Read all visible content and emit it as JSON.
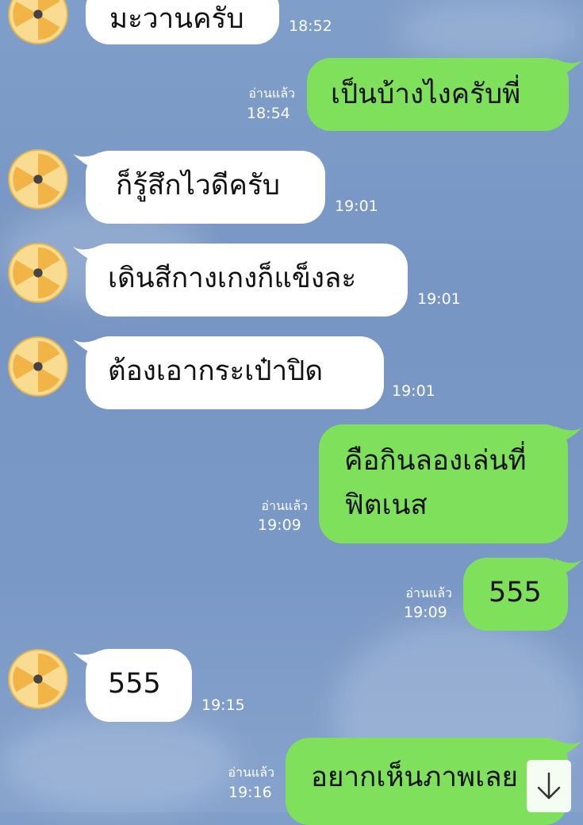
{
  "messages": [
    {
      "side": "in",
      "text": "มะวานครับ",
      "time": "18:52"
    },
    {
      "side": "out",
      "text": "เป็นบ้างไงครับพี่",
      "time": "18:54",
      "read": "อ่านแล้ว"
    },
    {
      "side": "in",
      "text": "ก็รู้สึกไวดีครับ",
      "time": "19:01"
    },
    {
      "side": "in",
      "text": "เดินสีกางเกงก็แข็งละ",
      "time": "19:01"
    },
    {
      "side": "in",
      "text": "ต้องเอากระเป๋าปิด",
      "time": "19:01"
    },
    {
      "side": "out",
      "text": "คือกินลองเล่นที่\nฟิตเนส",
      "time": "19:09",
      "read": "อ่านแล้ว"
    },
    {
      "side": "out",
      "text": "555",
      "time": "19:09",
      "read": "อ่านแล้ว"
    },
    {
      "side": "in",
      "text": "555",
      "time": "19:15"
    },
    {
      "side": "out",
      "text": "อยากเห็นภาพเลย",
      "time": "19:16",
      "read": "อ่านแล้ว"
    }
  ],
  "colors": {
    "incoming_bubble": "#ffffff",
    "outgoing_bubble": "#7fe05c",
    "background": "#7f9ec9"
  },
  "icons": {
    "avatar": "cd-disc-icon",
    "scroll_down": "arrow-down-icon"
  }
}
